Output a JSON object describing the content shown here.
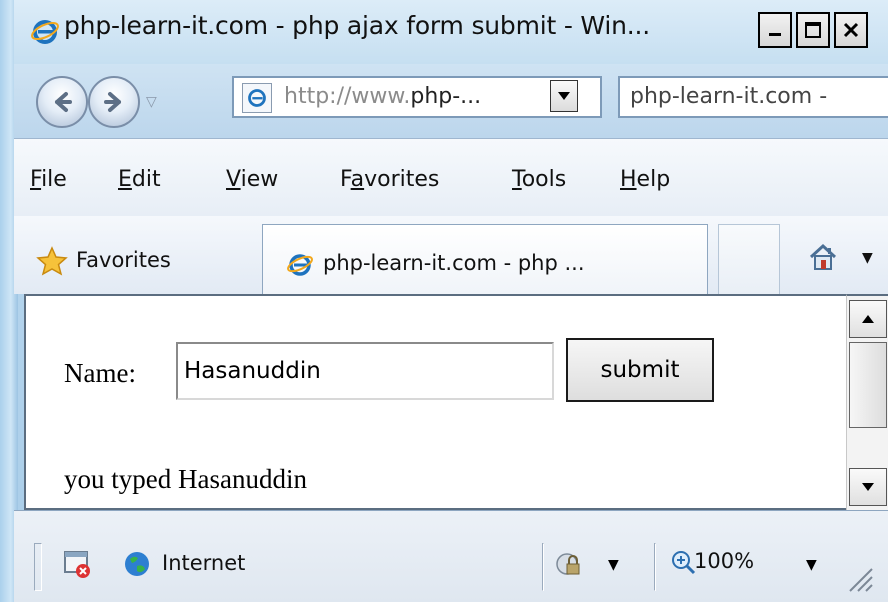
{
  "window": {
    "title": "php-learn-it.com - php ajax form submit - Win...",
    "controls": {
      "minimize": "_",
      "maximize": "☐",
      "close": "✕"
    }
  },
  "nav": {
    "address_prefix": "http://www.",
    "address_domain": "php-...",
    "search_text": "php-learn-it.com -"
  },
  "menu": {
    "items": [
      {
        "accel": "F",
        "rest": "ile"
      },
      {
        "accel": "E",
        "rest": "dit"
      },
      {
        "accel": "V",
        "rest": "iew"
      },
      {
        "prefix": "F",
        "accel": "a",
        "rest": "vorites"
      },
      {
        "accel": "T",
        "rest": "ools"
      },
      {
        "accel": "H",
        "rest": "elp"
      }
    ]
  },
  "favbar": {
    "favorites_label": "Favorites",
    "tab_label": "php-learn-it.com - php ..."
  },
  "page": {
    "name_label": "Name:",
    "name_value": "Hasanuddin",
    "submit_label": "submit",
    "result": "you typed Hasanuddin"
  },
  "status": {
    "zone": "Internet",
    "zoom": "100%"
  },
  "colors": {
    "frame": "#bcd9ef",
    "ie_blue": "#1e73be",
    "ie_orange": "#f2a81d"
  }
}
